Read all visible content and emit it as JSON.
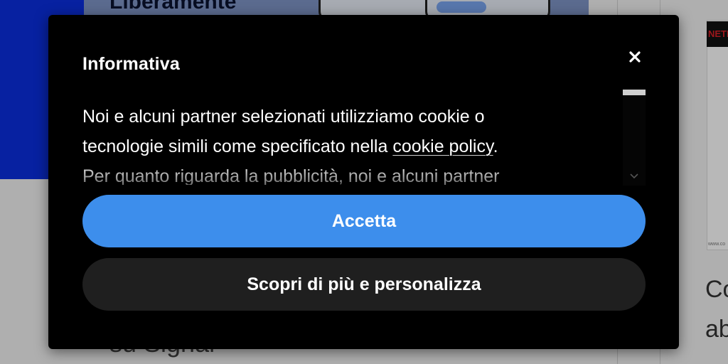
{
  "background": {
    "hero_text": "Liberamente",
    "side_logo": "NETFLIX",
    "side_caption": "www.co",
    "side_text_1": "Co",
    "side_text_2": "ab",
    "bottom_text": "su Signal"
  },
  "modal": {
    "title": "Informativa",
    "close_label": "×",
    "body": {
      "line1": "Noi e alcuni partner selezionati utilizziamo cookie o",
      "line2_before": "tecnologie simili come specificato nella ",
      "line2_link": "cookie policy",
      "line2_after": ".",
      "line3_before": "Per quanto riguarda la pubblicità, noi e alcuni ",
      "line3_link": "partner"
    },
    "accept_button": "Accetta",
    "customize_button": "Scopri di più e personalizza"
  },
  "colors": {
    "modal_bg": "#000000",
    "accept_bg": "#3d8eec",
    "customize_bg": "#1f1f1f",
    "text": "#ffffff"
  },
  "icons": {
    "close": "close-icon",
    "scroll_down": "chevron-down-icon"
  }
}
